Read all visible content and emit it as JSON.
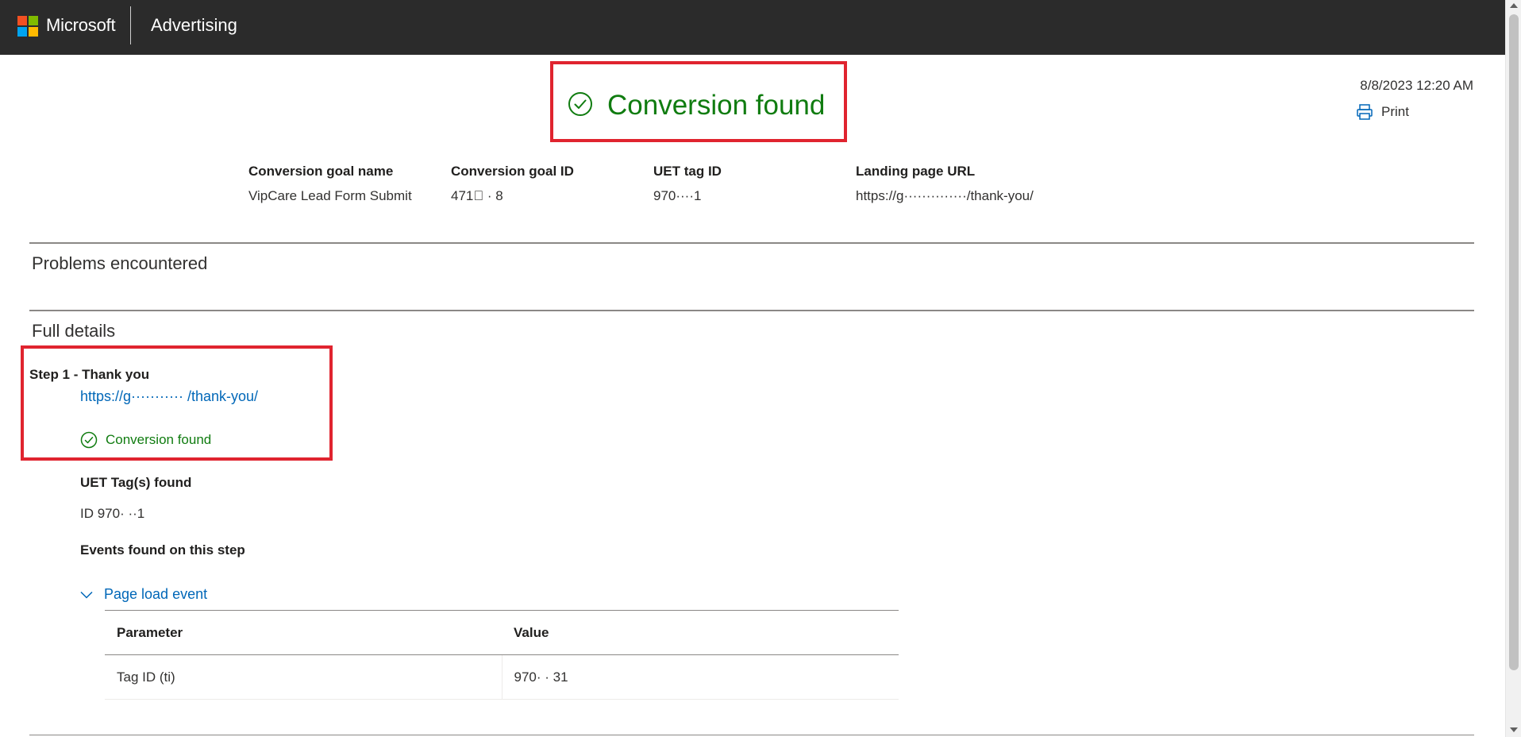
{
  "header": {
    "brand": "Microsoft",
    "product": "Advertising",
    "logo_colors": [
      "#f25022",
      "#7fba00",
      "#00a4ef",
      "#ffb900"
    ]
  },
  "status": {
    "title": "Conversion found",
    "icon": "check-circle-icon",
    "color": "#107c10"
  },
  "meta": {
    "timestamp": "8/8/2023 12:20 AM",
    "print_label": "Print"
  },
  "summary": {
    "goal_name_label": "Conversion goal name",
    "goal_name_value": "VipCare Lead Form Submit",
    "goal_id_label": "Conversion goal ID",
    "goal_id_value": "471⃨ · 8",
    "uet_tag_label": "UET tag ID",
    "uet_tag_value": "970····1",
    "landing_label": "Landing page URL",
    "landing_value": "https://g··············/thank-you/"
  },
  "sections": {
    "problems": "Problems encountered",
    "full_details": "Full details"
  },
  "step": {
    "title": "Step 1 - Thank you",
    "url": "https://g··········· /thank-you/",
    "status": "Conversion found",
    "uet_found_label": "UET Tag(s) found",
    "uet_found_value": "ID 970· ··1",
    "events_label": "Events found on this step"
  },
  "event": {
    "name": "Page load event",
    "columns": [
      "Parameter",
      "Value"
    ],
    "rows": [
      [
        "Tag ID (ti)",
        "970· · 31"
      ]
    ]
  }
}
